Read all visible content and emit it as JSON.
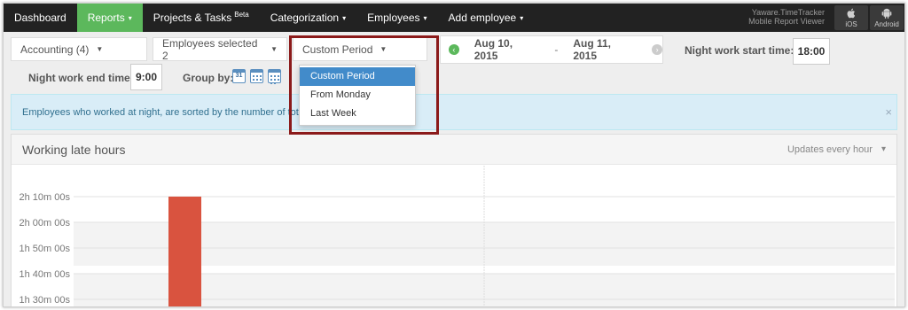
{
  "nav": {
    "items": [
      {
        "label": "Dashboard",
        "active": false,
        "caret": false
      },
      {
        "label": "Reports",
        "active": true,
        "caret": true
      },
      {
        "label": "Projects & Tasks",
        "active": false,
        "caret": false,
        "badge": "Beta"
      },
      {
        "label": "Categorization",
        "active": false,
        "caret": true
      },
      {
        "label": "Employees",
        "active": false,
        "caret": true
      },
      {
        "label": "Add employee",
        "active": false,
        "caret": true
      }
    ],
    "brand_line1": "Yaware.TimeTracker",
    "brand_line2": "Mobile Report Viewer",
    "ios_label": "iOS",
    "android_label": "Android"
  },
  "filters": {
    "department": "Accounting (4)",
    "employees": "Employees selected 2",
    "period": "Custom Period",
    "date_from": "Aug 10, 2015",
    "date_sep": "-",
    "date_to": "Aug 11, 2015",
    "night_start_label": "Night work start time:",
    "night_start_value": "18:00",
    "night_end_label": "Night work end time:",
    "night_end_value": "9:00",
    "group_by_label": "Group by:",
    "calendar_day": "31"
  },
  "period_menu": {
    "options": [
      "Custom Period",
      "From Monday",
      "Last Week"
    ],
    "selected_index": 0
  },
  "alert": {
    "text": "Employees who worked at night, are sorted by the number of total w",
    "close": "×"
  },
  "panel": {
    "title": "Working late hours",
    "updates": "Updates every hour"
  },
  "colors": {
    "nav_bg": "#222222",
    "nav_active": "#5cb85c",
    "bar": "#d9533f",
    "highlight": "#8b1a1a",
    "menu_active": "#428bca"
  },
  "chart_data": {
    "type": "bar",
    "y_ticks": [
      "2h 10m 00s",
      "2h 00m 00s",
      "1h 50m 00s",
      "1h 40m 00s",
      "1h 30m 00s"
    ],
    "y_tick_minutes": [
      130,
      120,
      110,
      100,
      90
    ],
    "ylim_minutes": [
      90,
      130
    ],
    "series": [
      {
        "values_minutes": [
          130,
          null
        ]
      }
    ],
    "grid": true
  }
}
